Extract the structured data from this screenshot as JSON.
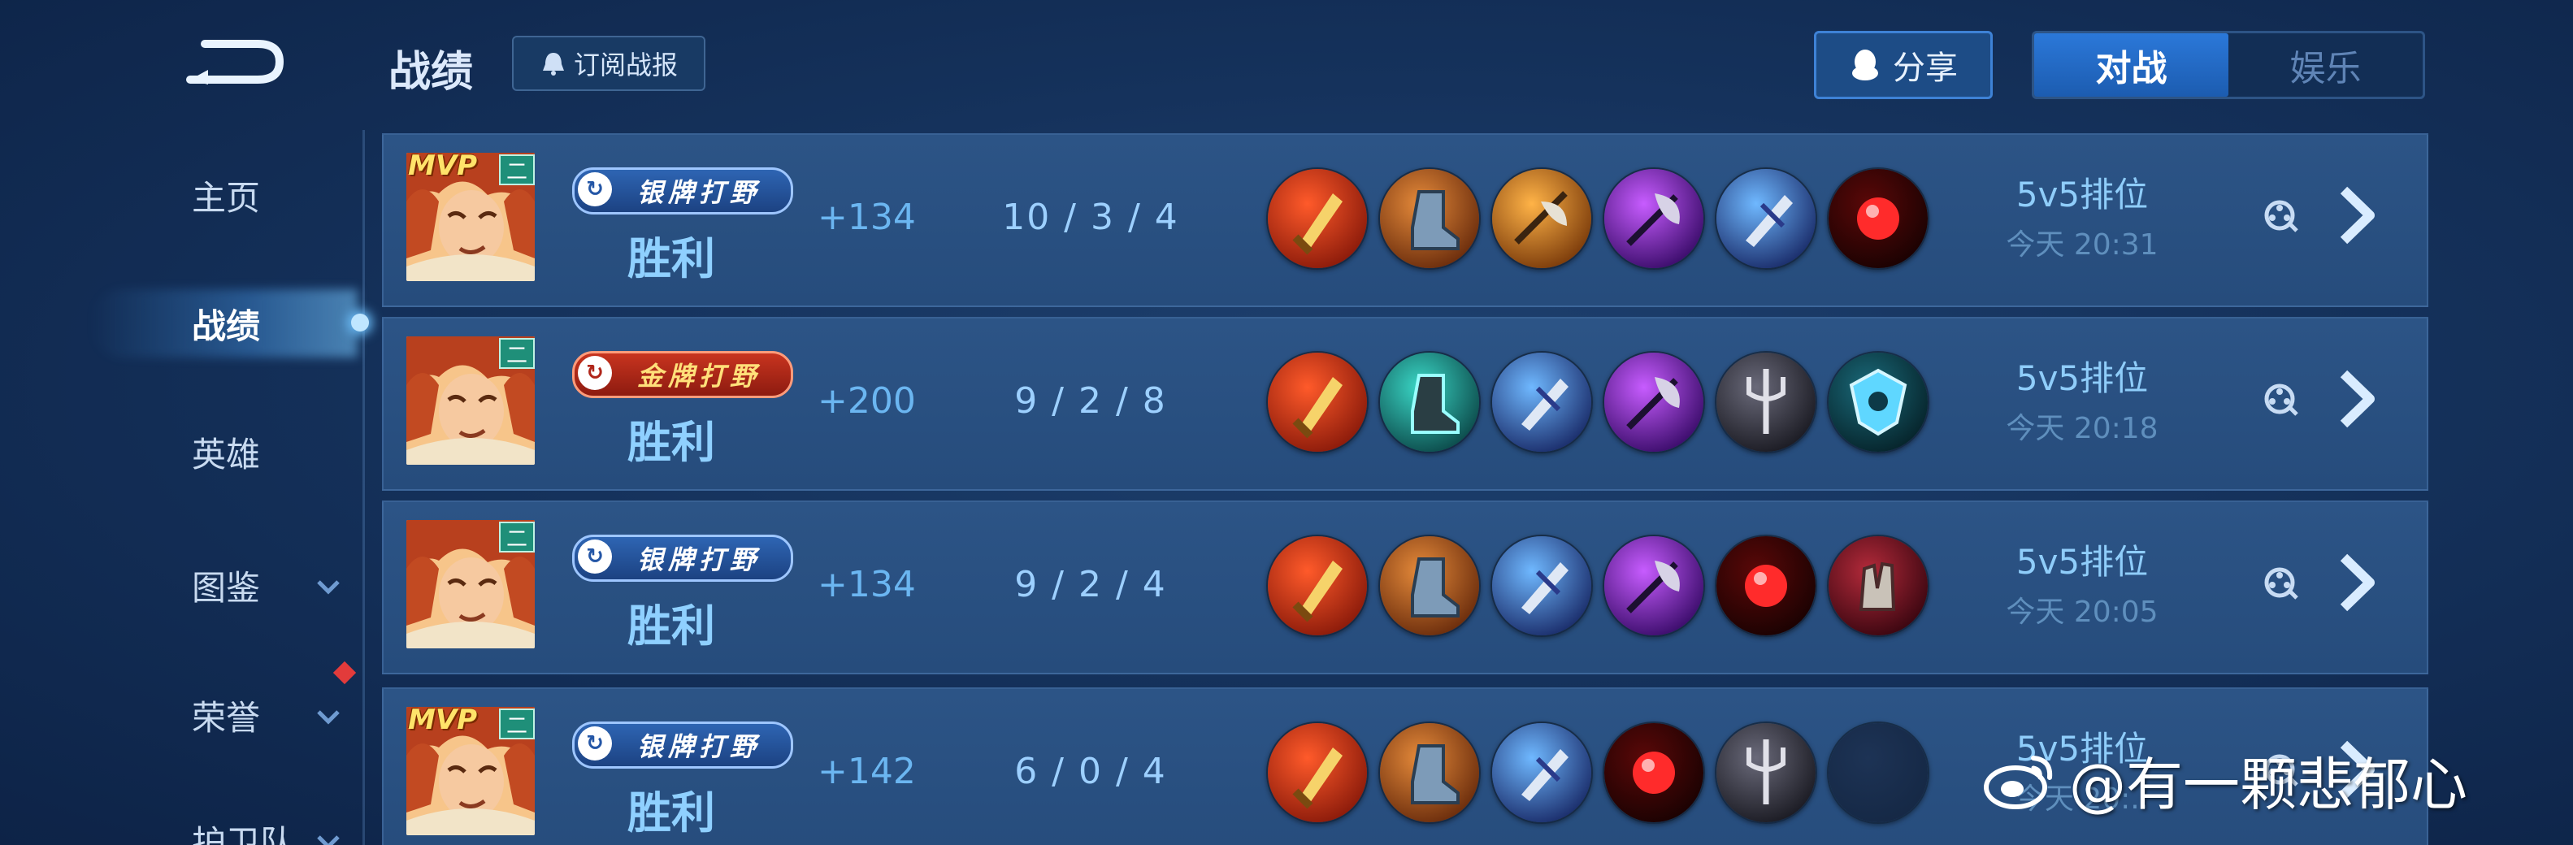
{
  "header": {
    "title": "战绩",
    "subscribe_label": "订阅战报",
    "share_label": "分享",
    "tabs": [
      {
        "label": "对战",
        "active": true
      },
      {
        "label": "娱乐",
        "active": false
      }
    ]
  },
  "sidebar": {
    "items": [
      {
        "label": "主页",
        "active": false,
        "has_chevron": false
      },
      {
        "label": "战绩",
        "active": true,
        "has_chevron": false
      },
      {
        "label": "英雄",
        "active": false,
        "has_chevron": false
      },
      {
        "label": "图鉴",
        "active": false,
        "has_chevron": true
      },
      {
        "label": "荣誉",
        "active": false,
        "has_chevron": true,
        "badge_color": "#e23b3b"
      },
      {
        "label": "护卫队",
        "active": false,
        "has_chevron": true
      }
    ]
  },
  "matches": [
    {
      "mvp": "MVP",
      "tier_badge": "二",
      "rank": "银牌打野",
      "rank_type": "silver",
      "result": "胜利",
      "points": "+134",
      "kda": "10 / 3 / 4",
      "items": [
        "sword-red",
        "boots-bronze",
        "axe-orange",
        "axe-purple",
        "blade-blue",
        "gem-red"
      ],
      "mode": "5v5排位",
      "time": "今天 20:31"
    },
    {
      "mvp": "",
      "tier_badge": "二",
      "rank": "金牌打野",
      "rank_type": "gold",
      "result": "胜利",
      "points": "+200",
      "kda": "9 / 2 / 8",
      "items": [
        "sword-red",
        "boots-teal",
        "blade-blue",
        "axe-purple",
        "trident-dark",
        "shield-cyan"
      ],
      "mode": "5v5排位",
      "time": "今天 20:18"
    },
    {
      "mvp": "",
      "tier_badge": "二",
      "rank": "银牌打野",
      "rank_type": "silver",
      "result": "胜利",
      "points": "+134",
      "kda": "9 / 2 / 4",
      "items": [
        "sword-red",
        "boots-bronze",
        "blade-blue",
        "axe-purple",
        "gem-red",
        "gauntlet-crimson"
      ],
      "mode": "5v5排位",
      "time": "今天 20:05"
    },
    {
      "mvp": "MVP",
      "tier_badge": "二",
      "rank": "银牌打野",
      "rank_type": "silver",
      "result": "胜利",
      "points": "+142",
      "kda": "6 / 0 / 4",
      "items": [
        "sword-red",
        "boots-bronze",
        "blade-blue",
        "gem-red",
        "trident-dark",
        "empty"
      ],
      "mode": "5v5排位",
      "time": "今天 20:.."
    }
  ],
  "watermark": "@有一颗悲郁心",
  "colors": {
    "background": "#15325c",
    "row": "#2a5183",
    "accent_blue": "#2b78d9",
    "result_text": "#8fd0ff"
  }
}
